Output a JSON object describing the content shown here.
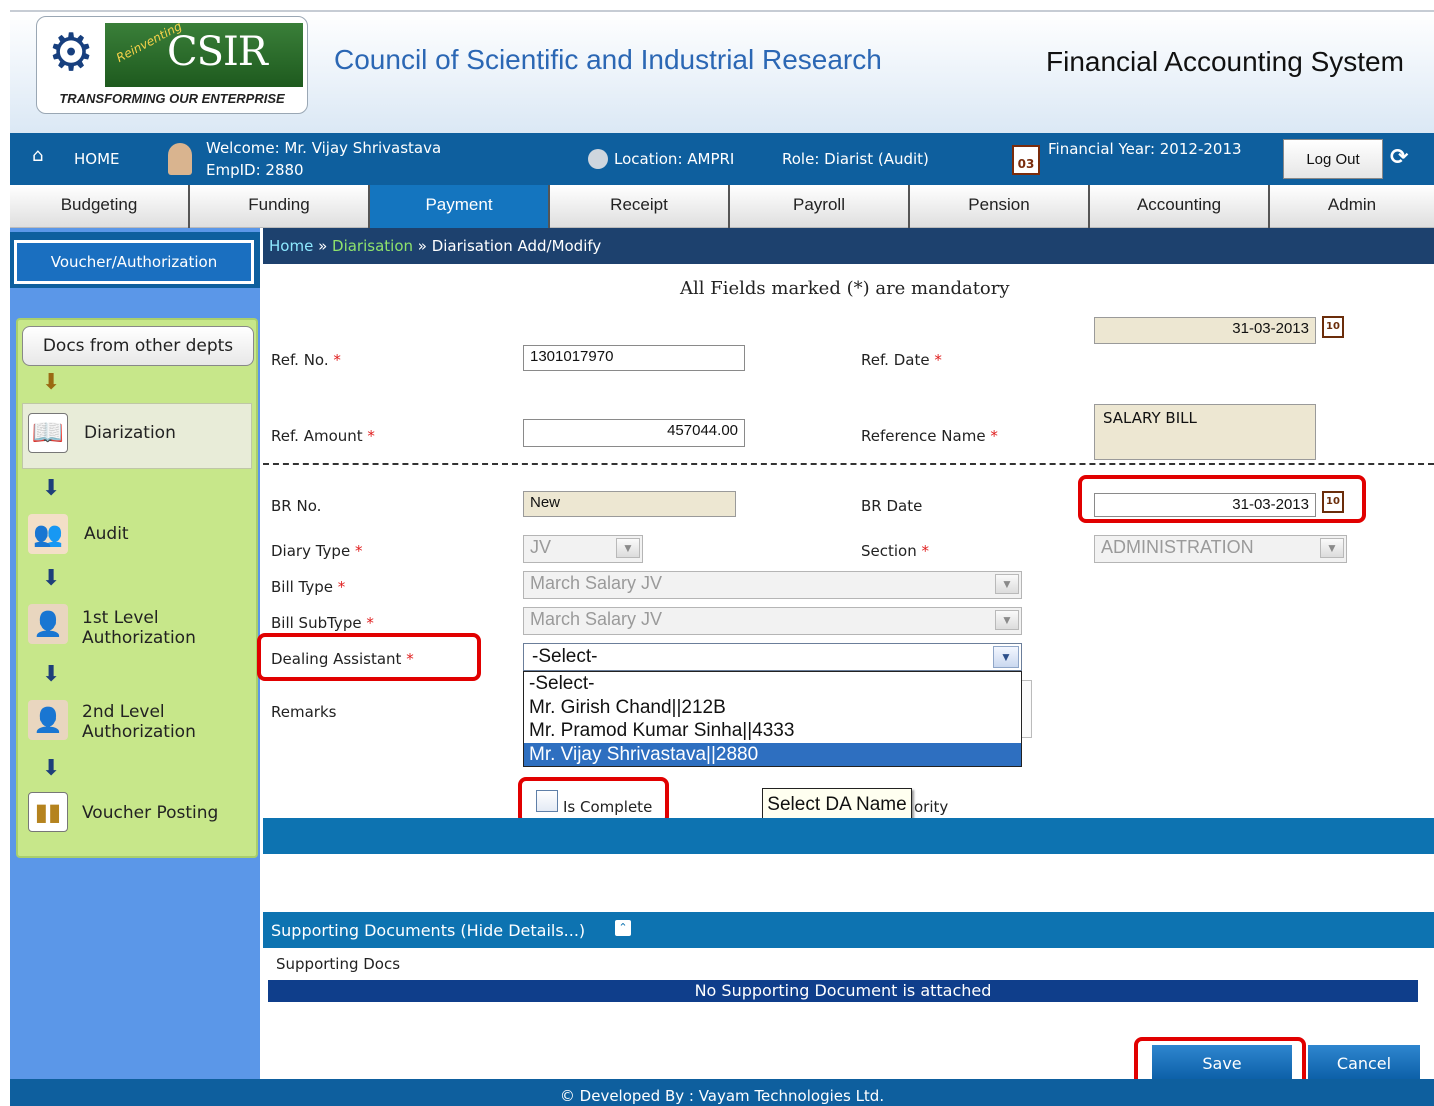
{
  "header": {
    "logo_tagline": "TRANSFORMING OUR ENTERPRISE",
    "logo_reinventing": "Reinventing",
    "logo_name": "CSIR",
    "org_title": "Council of Scientific and Industrial Research",
    "system_title": "Financial Accounting System"
  },
  "userbar": {
    "home": "HOME",
    "welcome": "Welcome: Mr. Vijay Shrivastava",
    "emp_id": "EmpID: 2880",
    "location": "Location: AMPRI",
    "role": "Role: Diarist (Audit)",
    "financial_year": "Financial  Year: 2012-2013",
    "calendar_day": "03",
    "logout": "Log Out"
  },
  "menu": [
    "Budgeting",
    "Funding",
    "Payment",
    "Receipt",
    "Payroll",
    "Pension",
    "Accounting",
    "Admin"
  ],
  "menu_active": "Payment",
  "sidebar": {
    "tab": "Voucher/Authorization",
    "docs_button": "Docs from other depts",
    "steps": [
      {
        "label": "Diarization",
        "icon": "book-icon"
      },
      {
        "label": "Audit",
        "icon": "users-icon"
      },
      {
        "label": "1st Level Authorization",
        "icon": "user-female-icon"
      },
      {
        "label": "2nd Level Authorization",
        "icon": "user-male-icon"
      },
      {
        "label": "Voucher Posting",
        "icon": "binders-icon"
      }
    ],
    "step_labels": {
      "diarization": "Diarization",
      "audit": "Audit",
      "level1_a": "1st Level",
      "level1_b": "Authorization",
      "level2_a": "2nd Level",
      "level2_b": "Authorization",
      "voucher_posting": "Voucher Posting"
    }
  },
  "breadcrumb": {
    "home": "Home",
    "sep1": " » ",
    "diarisation": "Diarisation",
    "sep2": " » ",
    "current": "Diarisation Add/Modify"
  },
  "form": {
    "mandatory_note": "All Fields marked (*) are mandatory",
    "req_mark": " *",
    "ref_no_label": "Ref. No.",
    "ref_no_value": "1301017970",
    "ref_date_label": "Ref. Date",
    "ref_date_value": "31-03-2013",
    "ref_amount_label": "Ref. Amount",
    "ref_amount_value": "457044.00",
    "reference_name_label": "Reference Name",
    "reference_name_value": "SALARY BILL",
    "br_no_label": "BR No.",
    "br_no_value": "New",
    "br_date_label": "BR Date",
    "br_date_value": "31-03-2013",
    "diary_type_label": "Diary Type",
    "diary_type_value": "JV",
    "section_label": "Section",
    "section_value": "ADMINISTRATION",
    "bill_type_label": "Bill Type",
    "bill_type_value": "March Salary JV",
    "bill_subtype_label": "Bill SubType",
    "bill_subtype_value": "March Salary JV",
    "dealing_assistant_label": "Dealing Assistant",
    "dealing_assistant_value": "-Select-",
    "dealing_assistant_options": [
      "-Select-",
      "Mr. Girish Chand||212B",
      "Mr. Pramod Kumar Sinha||4333",
      "Mr. Vijay Shrivastava||2880"
    ],
    "dealing_assistant_opt0": "-Select-",
    "dealing_assistant_opt1": "Mr. Girish Chand||212B",
    "dealing_assistant_opt2": "Mr. Pramod Kumar Sinha||4333",
    "dealing_assistant_opt3": "Mr. Vijay Shrivastava||2880",
    "dealing_assistant_highlighted": "Mr. Vijay Shrivastava||2880",
    "remarks_label": "Remarks",
    "is_complete_label": "Is Complete",
    "is_complete_checked": false,
    "priority_partial": "ority",
    "tooltip": "Select DA Name",
    "calendar_icon_text": "10"
  },
  "supporting_docs": {
    "header": "Supporting Documents (Hide Details...)",
    "subheader": "Supporting Docs",
    "empty_message": "No Supporting Document is attached"
  },
  "buttons": {
    "save": "Save",
    "cancel": "Cancel"
  },
  "footer": "© Developed By : Vayam Technologies Ltd.",
  "colors": {
    "primary_blue": "#0e5f9e",
    "active_menu": "#1475bf",
    "highlight_red": "#e10000",
    "sidebar_green": "#c7e78a"
  }
}
